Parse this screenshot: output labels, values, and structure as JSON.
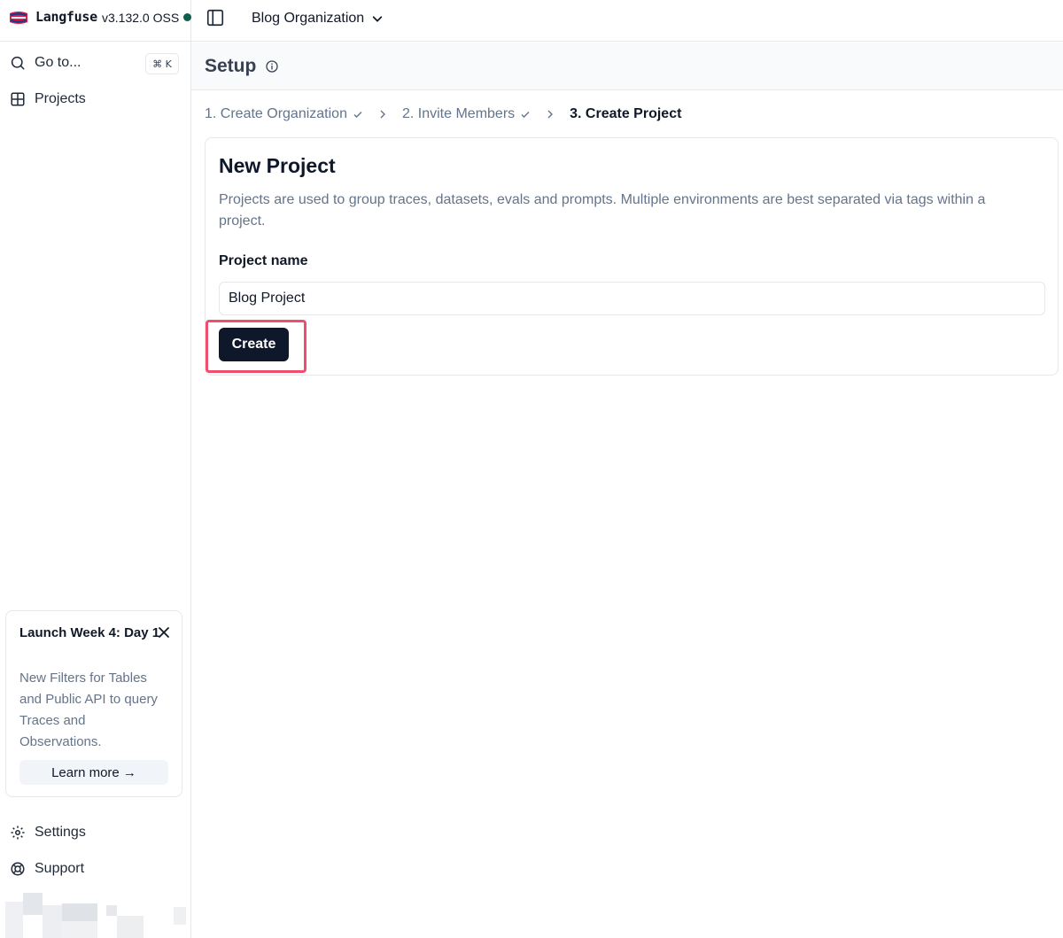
{
  "brand": {
    "name": "Langfuse",
    "version": "v3.132.0 OSS",
    "status_color": "#0f5f4b"
  },
  "sidebar": {
    "goto": {
      "label": "Go to...",
      "shortcut": "⌘ K",
      "icon": "search-icon"
    },
    "items": [
      {
        "label": "Projects",
        "icon": "grid-icon"
      }
    ],
    "bottom_items": [
      {
        "label": "Settings",
        "icon": "gear-icon"
      },
      {
        "label": "Support",
        "icon": "lifebuoy-icon"
      }
    ],
    "launch": {
      "title": "Launch Week 4: Day 1",
      "description": "New Filters for Tables and Public API to query Traces and Observations.",
      "cta": "Learn more →"
    }
  },
  "topbar": {
    "organization": "Blog Organization"
  },
  "page": {
    "title": "Setup",
    "steps": [
      {
        "label": "1. Create Organization",
        "done": true
      },
      {
        "label": "2. Invite Members",
        "done": true
      },
      {
        "label": "3. Create Project",
        "done": false
      }
    ]
  },
  "form": {
    "title": "New Project",
    "description": "Projects are used to group traces, datasets, evals and prompts. Multiple environments are best separated via tags within a project.",
    "field_label": "Project name",
    "field_value": "Blog Project",
    "submit_label": "Create",
    "highlight_color": "#ef4e6e"
  }
}
